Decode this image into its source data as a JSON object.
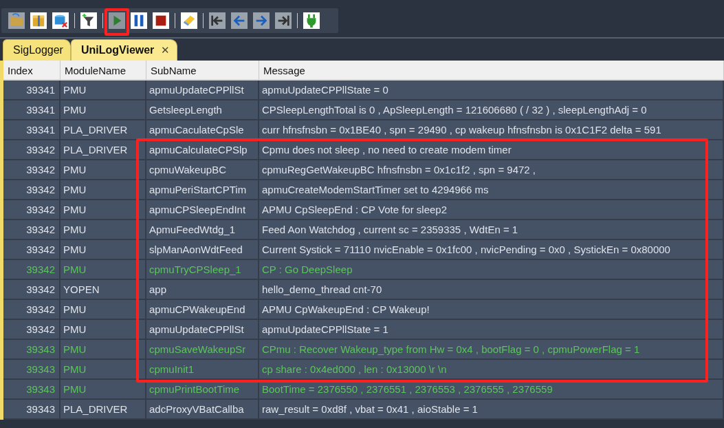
{
  "toolbar": {
    "highlight_frame": true,
    "buttons": [
      {
        "kind": "open",
        "selected": false
      },
      {
        "kind": "archive",
        "selected": false
      },
      {
        "kind": "db-delete",
        "selected": false
      },
      {
        "kind": "filter",
        "selected": false
      },
      {
        "kind": "play",
        "selected": true
      },
      {
        "kind": "pause",
        "selected": false
      },
      {
        "kind": "stop",
        "selected": false
      },
      {
        "kind": "eraser",
        "selected": false
      },
      {
        "kind": "first",
        "selected": false
      },
      {
        "kind": "prev",
        "selected": false
      },
      {
        "kind": "next",
        "selected": false
      },
      {
        "kind": "last",
        "selected": false
      },
      {
        "kind": "plug",
        "selected": false
      }
    ]
  },
  "tabs": [
    {
      "label": "SigLogger",
      "selected": false
    },
    {
      "label": "UniLogViewer",
      "selected": true,
      "close": "✕"
    }
  ],
  "table": {
    "highlight_frame": true,
    "columns": [
      "Index",
      "ModuleName",
      "SubName",
      "Message"
    ],
    "rows": [
      {
        "highlighted": false,
        "cells": [
          "39341",
          "PMU",
          "apmuUpdateCPPllSt",
          "apmuUpdateCPPllState = 0"
        ]
      },
      {
        "highlighted": false,
        "cells": [
          "39341",
          "PMU",
          "GetsleepLength",
          "CPSleepLengthTotal is 0 , ApSleepLength = 121606680 ( / 32 ) , sleepLengthAdj = 0"
        ]
      },
      {
        "highlighted": false,
        "cells": [
          "39341",
          "PLA_DRIVER",
          "apmuCaculateCpSle",
          "curr hfnsfnsbn = 0x1BE40 , spn = 29490 , cp wakeup hfnsfnsbn is 0x1C1F2 delta = 591"
        ]
      },
      {
        "highlighted": false,
        "cells": [
          "39342",
          "PLA_DRIVER",
          "apmuCalculateCPSlp",
          "Cpmu does not sleep , no need to create modem timer"
        ]
      },
      {
        "highlighted": false,
        "cells": [
          "39342",
          "PMU",
          "cpmuWakeupBC",
          "cpmuRegGetWakeupBC hfnsfnsbn = 0x1c1f2 , spn = 9472 ,"
        ]
      },
      {
        "highlighted": false,
        "cells": [
          "39342",
          "PMU",
          "apmuPeriStartCPTim",
          "apmuCreateModemStartTimer set to 4294966 ms"
        ]
      },
      {
        "highlighted": false,
        "cells": [
          "39342",
          "PMU",
          "apmuCPSleepEndInt",
          "APMU CpSleepEnd : CP Vote for sleep2"
        ]
      },
      {
        "highlighted": false,
        "cells": [
          "39342",
          "PMU",
          "ApmuFeedWtdg_1",
          "Feed Aon Watchdog , current sc = 2359335 , WdtEn = 1"
        ]
      },
      {
        "highlighted": false,
        "cells": [
          "39342",
          "PMU",
          "slpManAonWdtFeed",
          "Current Systick = 71110 nvicEnable = 0x1fc00 , nvicPending = 0x0 , SystickEn = 0x80000"
        ]
      },
      {
        "highlighted": true,
        "cells": [
          "39342",
          "PMU",
          "cpmuTryCPSleep_1",
          "CP : Go DeepSleep"
        ]
      },
      {
        "highlighted": false,
        "cells": [
          "39342",
          "YOPEN",
          "app",
          "hello_demo_thread cnt-70"
        ]
      },
      {
        "highlighted": false,
        "cells": [
          "39342",
          "PMU",
          "apmuCPWakeupEnd",
          "APMU CpWakeupEnd : CP Wakeup!"
        ]
      },
      {
        "highlighted": false,
        "cells": [
          "39342",
          "PMU",
          "apmuUpdateCPPllSt",
          "apmuUpdateCPPllState = 1"
        ]
      },
      {
        "highlighted": true,
        "cells": [
          "39343",
          "PMU",
          "cpmuSaveWakeupSr",
          "CPmu : Recover Wakeup_type from Hw = 0x4 , bootFlag = 0 , cpmuPowerFlag = 1"
        ]
      },
      {
        "highlighted": true,
        "cells": [
          "39343",
          "PMU",
          "cpmuInit1",
          "cp share : 0x4ed000 , len : 0x13000 \\r \\n"
        ]
      },
      {
        "highlighted": true,
        "cells": [
          "39343",
          "PMU",
          "cpmuPrintBootTime",
          "BootTime = 2376550 , 2376551 , 2376553 , 2376555 , 2376559"
        ]
      },
      {
        "highlighted": false,
        "cells": [
          "39343",
          "PLA_DRIVER",
          "adcProxyVBatCallba",
          "raw_result = 0xd8f , vbat = 0x41 , aioStable = 1"
        ]
      }
    ]
  }
}
